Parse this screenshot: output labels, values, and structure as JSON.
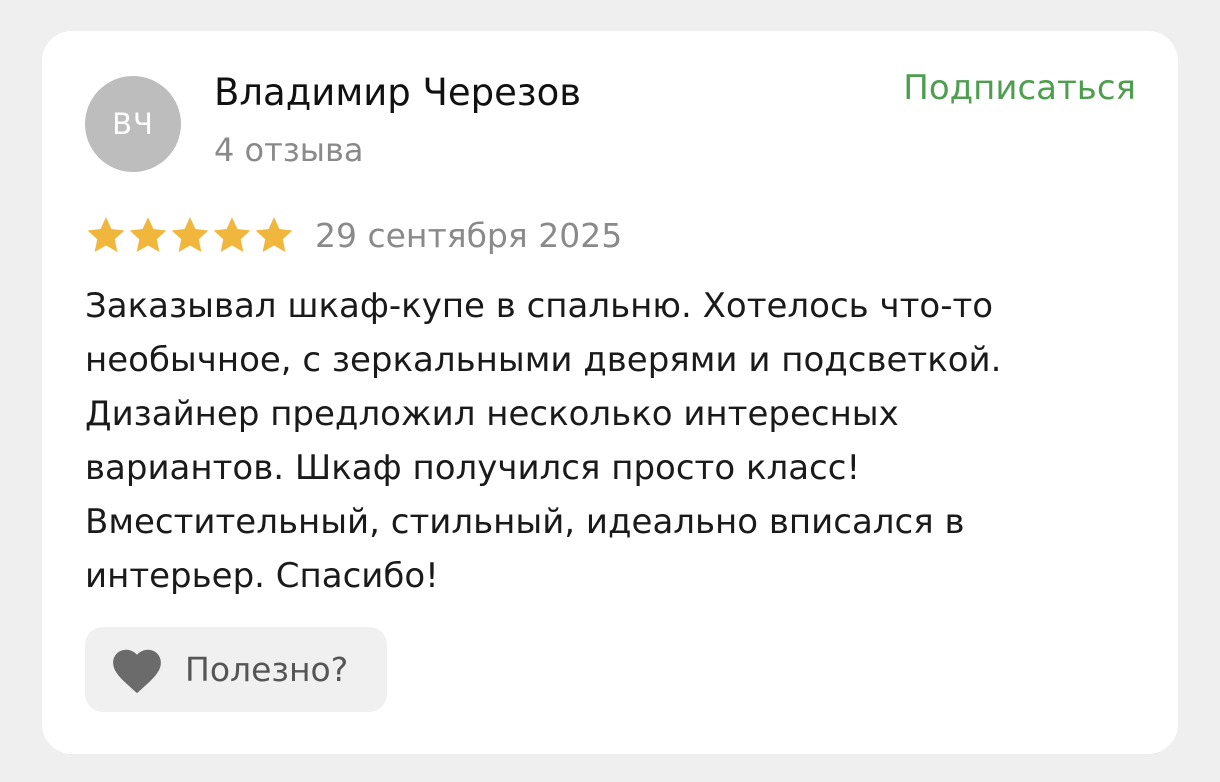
{
  "review": {
    "author": {
      "initials": "ВЧ",
      "name": "Владимир Черезов",
      "review_count": "4 отзыва"
    },
    "subscribe_label": "Подписаться",
    "rating": 5,
    "rating_max": 5,
    "date": "29 сентября 2025",
    "text_lines": [
      "Заказывал шкаф-купе в спальню. Хотелось что-то",
      "необычное, с зеркальными дверями и подсветкой.",
      "Дизайнер предложил несколько интересных",
      "вариантов. Шкаф получился просто класс!",
      "Вместительный, стильный, идеально вписался в",
      "интерьер. Спасибо!"
    ],
    "helpful_label": "Полезно?"
  },
  "icons": {
    "star": "star-icon",
    "heart": "heart-icon"
  },
  "colors": {
    "background": "#efefef",
    "card": "#ffffff",
    "avatar": "#bdbdbd",
    "star": "#f0b73c",
    "subscribe": "#4f9e4f",
    "muted_text": "#8a8a8a",
    "heart": "#6b6b6b",
    "helpful_bg": "#f0f0f0"
  }
}
